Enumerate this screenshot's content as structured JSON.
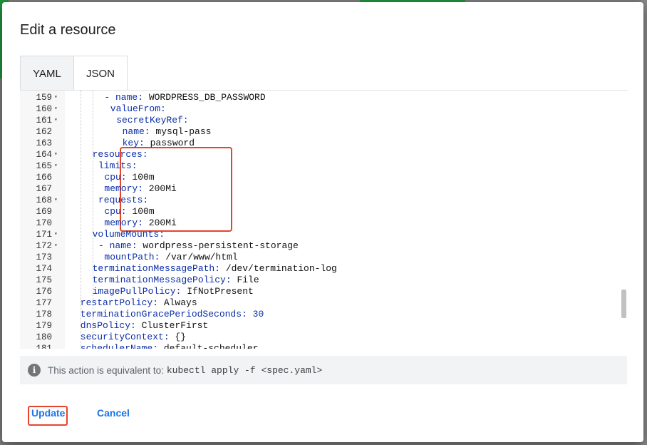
{
  "dialog": {
    "title": "Edit a resource",
    "tabs": [
      {
        "label": "YAML",
        "active": false
      },
      {
        "label": "JSON",
        "active": true
      }
    ]
  },
  "editor": {
    "lines": [
      {
        "num": "159",
        "fold": true,
        "segments": [
          {
            "t": "- ",
            "c": "d"
          },
          {
            "t": "name:",
            "c": "k"
          },
          {
            "t": " WORDPRESS_DB_PASSWORD",
            "c": "v"
          }
        ]
      },
      {
        "num": "160",
        "fold": true,
        "segments": [
          {
            "t": "valueFrom:",
            "c": "k"
          }
        ]
      },
      {
        "num": "161",
        "fold": true,
        "segments": [
          {
            "t": "secretKeyRef:",
            "c": "k"
          }
        ]
      },
      {
        "num": "162",
        "fold": false,
        "segments": [
          {
            "t": "name:",
            "c": "k"
          },
          {
            "t": " mysql-pass",
            "c": "v"
          }
        ]
      },
      {
        "num": "163",
        "fold": false,
        "segments": [
          {
            "t": "key:",
            "c": "k"
          },
          {
            "t": " password",
            "c": "v"
          }
        ]
      },
      {
        "num": "164",
        "fold": true,
        "segments": [
          {
            "t": "resources:",
            "c": "k"
          }
        ]
      },
      {
        "num": "165",
        "fold": true,
        "segments": [
          {
            "t": "limits:",
            "c": "k"
          }
        ]
      },
      {
        "num": "166",
        "fold": false,
        "segments": [
          {
            "t": "cpu:",
            "c": "k"
          },
          {
            "t": " 100m",
            "c": "v"
          }
        ]
      },
      {
        "num": "167",
        "fold": false,
        "segments": [
          {
            "t": "memory:",
            "c": "k"
          },
          {
            "t": " 200Mi",
            "c": "v"
          }
        ]
      },
      {
        "num": "168",
        "fold": true,
        "segments": [
          {
            "t": "requests:",
            "c": "k"
          }
        ]
      },
      {
        "num": "169",
        "fold": false,
        "segments": [
          {
            "t": "cpu:",
            "c": "k"
          },
          {
            "t": " 100m",
            "c": "v"
          }
        ]
      },
      {
        "num": "170",
        "fold": false,
        "segments": [
          {
            "t": "memory:",
            "c": "k"
          },
          {
            "t": " 200Mi",
            "c": "v"
          }
        ]
      },
      {
        "num": "171",
        "fold": true,
        "segments": [
          {
            "t": "volumeMounts:",
            "c": "k"
          }
        ]
      },
      {
        "num": "172",
        "fold": true,
        "segments": [
          {
            "t": "- ",
            "c": "d"
          },
          {
            "t": "name:",
            "c": "k"
          },
          {
            "t": " wordpress-persistent-storage",
            "c": "v"
          }
        ]
      },
      {
        "num": "173",
        "fold": false,
        "segments": [
          {
            "t": "mountPath:",
            "c": "k"
          },
          {
            "t": " /var/www/html",
            "c": "v"
          }
        ]
      },
      {
        "num": "174",
        "fold": false,
        "segments": [
          {
            "t": "terminationMessagePath:",
            "c": "k"
          },
          {
            "t": " /dev/termination-log",
            "c": "v"
          }
        ]
      },
      {
        "num": "175",
        "fold": false,
        "segments": [
          {
            "t": "terminationMessagePolicy:",
            "c": "k"
          },
          {
            "t": " File",
            "c": "v"
          }
        ]
      },
      {
        "num": "176",
        "fold": false,
        "segments": [
          {
            "t": "imagePullPolicy:",
            "c": "k"
          },
          {
            "t": " IfNotPresent",
            "c": "v"
          }
        ]
      },
      {
        "num": "177",
        "fold": false,
        "segments": [
          {
            "t": "restartPolicy:",
            "c": "k"
          },
          {
            "t": " Always",
            "c": "v"
          }
        ]
      },
      {
        "num": "178",
        "fold": false,
        "segments": [
          {
            "t": "terminationGracePeriodSeconds:",
            "c": "k"
          },
          {
            "t": " 30",
            "c": "n"
          }
        ]
      },
      {
        "num": "179",
        "fold": false,
        "segments": [
          {
            "t": "dnsPolicy:",
            "c": "k"
          },
          {
            "t": " ClusterFirst",
            "c": "v"
          }
        ]
      },
      {
        "num": "180",
        "fold": false,
        "segments": [
          {
            "t": "securityContext:",
            "c": "k"
          },
          {
            "t": " {}",
            "c": "v"
          }
        ]
      },
      {
        "num": "181",
        "fold": false,
        "segments": [
          {
            "t": "schedulerName:",
            "c": "k"
          },
          {
            "t": " default-scheduler",
            "c": "v"
          }
        ]
      }
    ]
  },
  "info": {
    "icon": "info-icon",
    "text": "This action is equivalent to:",
    "command": "kubectl apply -f <spec.yaml>"
  },
  "actions": {
    "update_label": "Update",
    "cancel_label": "Cancel"
  },
  "colors": {
    "accent": "#1a73e8",
    "highlight": "#e8432c",
    "yaml_key": "#0b2ea8"
  }
}
